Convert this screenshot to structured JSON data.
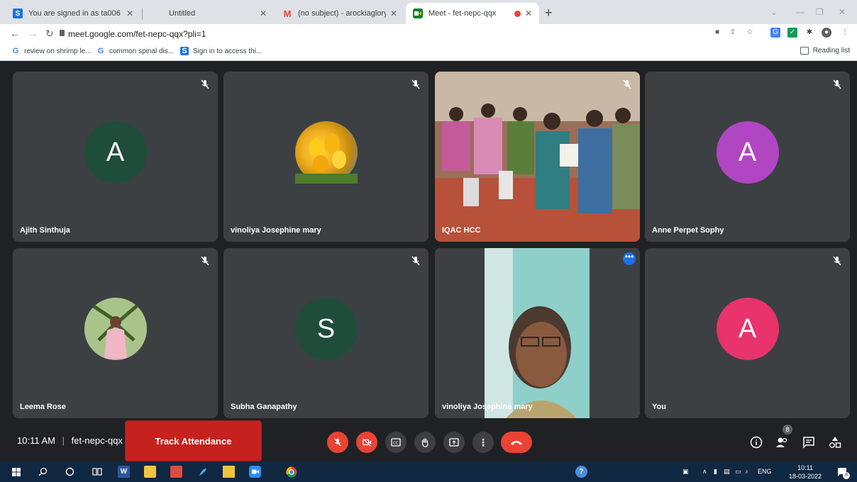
{
  "browser": {
    "tabs": [
      {
        "title": "You are signed in as ta006",
        "favicon": "S"
      },
      {
        "title": "Untitled",
        "favicon": ""
      },
      {
        "title": "(no subject) - arockiaglory@holy",
        "favicon": "M"
      },
      {
        "title": "Meet - fet-nepc-qqx",
        "favicon": "meet"
      }
    ],
    "url": "meet.google.com/fet-nepc-qqx?pli=1",
    "bookmarks": [
      {
        "label": "review on shrimp le...",
        "icon": "G"
      },
      {
        "label": "common spinal dis...",
        "icon": "G"
      },
      {
        "label": "Sign in to access thi...",
        "icon": "S"
      }
    ],
    "reading_list": "Reading list",
    "new_tab": "+"
  },
  "meet": {
    "participants": [
      {
        "name": "Ajith Sinthuja",
        "initial": "A",
        "color": "#1e4d3a"
      },
      {
        "name": "vinoliya Josephine mary",
        "initial": "",
        "color": "#d9a21c"
      },
      {
        "name": "IQAC HCC",
        "initial": "",
        "color": "#8a4a3a"
      },
      {
        "name": "Anne Perpet Sophy",
        "initial": "A",
        "color": "#b146c2"
      },
      {
        "name": "Leema Rose",
        "initial": "",
        "color": "#6d8c4a"
      },
      {
        "name": "Subha Ganapathy",
        "initial": "S",
        "color": "#1e4d3a"
      },
      {
        "name": "vinoliya Josephine mary",
        "initial": "",
        "color": "#5f8f86"
      },
      {
        "name": "You",
        "initial": "A",
        "color": "#e8336d"
      }
    ],
    "time": "10:11 AM",
    "separator": "|",
    "meeting_code": "fet-nepc-qqx",
    "track_attendance": "Track Attendance",
    "participant_count": "8"
  },
  "taskbar": {
    "lang": "ENG",
    "time": "10:11",
    "date": "18-03-2022",
    "notifications": "8"
  }
}
